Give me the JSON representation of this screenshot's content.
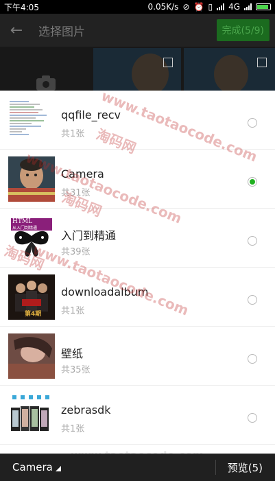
{
  "status_bar": {
    "time": "下午4:05",
    "net_speed": "0.05K/s",
    "network": "4G",
    "icons": [
      "no-sound-icon",
      "alarm-icon",
      "vibrate-icon",
      "signal-icon",
      "battery-charging-icon"
    ],
    "battery_color": "#4cd44c"
  },
  "app_bar": {
    "title": "选择图片",
    "done_label": "完成(5/9)",
    "accent": "#1b6b1f"
  },
  "albums": [
    {
      "name": "qqfile_recv",
      "count": "共1张",
      "selected": false
    },
    {
      "name": "Camera",
      "count": "共31张",
      "selected": true
    },
    {
      "name": "入门到精通",
      "count": "共39张",
      "selected": false
    },
    {
      "name": "downloadalbum",
      "count": "共1张",
      "selected": false
    },
    {
      "name": "壁纸",
      "count": "共35张",
      "selected": false
    },
    {
      "name": "zebrasdk",
      "count": "共1张",
      "selected": false
    }
  ],
  "book_cover": {
    "line1": "HTML",
    "line2": "从入门到精通"
  },
  "download_cover_text": "第4期",
  "bottom_bar": {
    "album_label": "Camera",
    "preview_label": "预览(5)"
  },
  "watermarks": {
    "url": "www.taotaocode.com",
    "cn": "淘码网",
    "footer": "www.taotaocode.com"
  },
  "selection_color": "#20b020"
}
